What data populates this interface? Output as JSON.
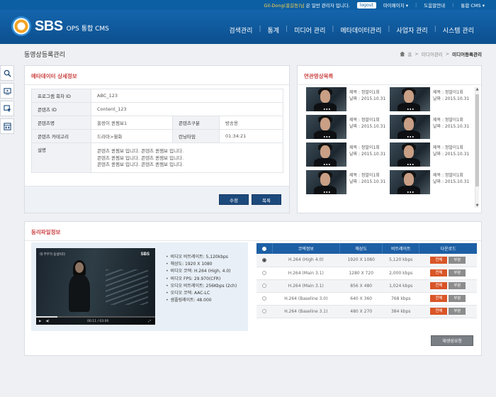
{
  "topbar": {
    "user": "Gil-Dong(홍길동)님",
    "greeting": "은 일반 관리자 입니다.",
    "logout": "logout",
    "mypage": "마이페이지 ▾",
    "customer_center": "도움말안내",
    "integrated": "통합 CMS ▾"
  },
  "header": {
    "logo": "SBS",
    "subtitle": "OPS 통합 CMS",
    "nav": [
      "검색관리",
      "통계",
      "미디어 관리",
      "메타데이터관리",
      "사업자 관리",
      "시스템 관리"
    ]
  },
  "page": {
    "title": "동영상등록관리",
    "breadcrumb": [
      "홈",
      "미디어관리"
    ],
    "breadcrumb_current": "미디어등록관리"
  },
  "quickbar": [
    "search-zoom",
    "monitor",
    "download",
    "calculator"
  ],
  "meta": {
    "title": "메타데이터 상세정보",
    "program_id_label": "프로그램 회차 ID",
    "program_id": "ABC_123",
    "content_id_label": "콘텐츠 ID",
    "content_id": "Content_123",
    "content_title_label": "콘텐츠명",
    "content_title": "홍랑이 퀸젬보1",
    "content_type_label": "콘텐츠구분",
    "content_type": "방송용",
    "category_label": "콘텐츠 카테고리",
    "category": "드라마>월화",
    "runtime_label": "런닝타임",
    "runtime": "01:34:21",
    "desc_label": "설명",
    "desc_lines": [
      "콘텐츠 퀸젬보 입니다.   콘텐츠 퀸젬보 입니다.",
      "콘텐츠 퀸젬보 입니다.   콘텐츠 퀸젬보 입니다.",
      "콘텐츠 퀸젬보 입니다.   콘텐츠 퀸젬보 입니다."
    ],
    "edit_button": "수정",
    "list_button": "목록"
  },
  "related": {
    "title": "연관영상목록",
    "items": [
      {
        "title": "제목 : 정말이1회",
        "date": "날짜 : 2015.10.31"
      },
      {
        "title": "제목 : 정말이1회",
        "date": "날짜 : 2015.10.31"
      },
      {
        "title": "제목 : 정말이1회",
        "date": "날짜 : 2015.10.31"
      },
      {
        "title": "제목 : 정말이1회",
        "date": "날짜 : 2015.10.31"
      },
      {
        "title": "제목 : 정말이1회",
        "date": "날짜 : 2015.10.31"
      },
      {
        "title": "제목 : 정말이1회",
        "date": "날짜 : 2015.10.31"
      },
      {
        "title": "제목 : 정말이1회",
        "date": "날짜 : 2015.10.31"
      },
      {
        "title": "제목 : 정말이1회",
        "date": "날짜 : 2015.10.31"
      }
    ]
  },
  "files": {
    "title": "동리파일정보",
    "player": {
      "caption": "대 부부가 동생이다",
      "logo": "SBS",
      "time": "00:11 / 03:00",
      "progress": 0.18
    },
    "specs": [
      "비디오 비트레이트: 5,120kbps",
      "해상도: 1920 X 1080",
      "비디오 코덱: H.264 (High, 4.0)",
      "비디오 FPS: 29.970(CFR)",
      "오디오 비트레이트: 256Kbps (2ch)",
      "오디오 코덱: AAC-LC",
      "샘플링레이트: 48.000"
    ],
    "columns": [
      "코덱정보",
      "해상도",
      "비트레이트",
      "다운로드"
    ],
    "rows": [
      {
        "codec": "H.264 (High 4.0)",
        "resolution": "1920 X 1080",
        "bitrate": "5,120 kbps"
      },
      {
        "codec": "H.264 (Main 3.1)",
        "resolution": "1280 X 720",
        "bitrate": "2,000 kbps"
      },
      {
        "codec": "H.264 (Main 3.1)",
        "resolution": "856 X 480",
        "bitrate": "1,024 kbps"
      },
      {
        "codec": "H.264 (Baseline 3.0)",
        "resolution": "640 X 360",
        "bitrate": "768 kbps"
      },
      {
        "codec": "H.264 (Baseline 3.1)",
        "resolution": "480 X 270",
        "bitrate": "384 kbps"
      }
    ],
    "selected_row": 0,
    "dl_all": "전체",
    "dl_part": "부분",
    "reencode_button": "재생성요청"
  }
}
